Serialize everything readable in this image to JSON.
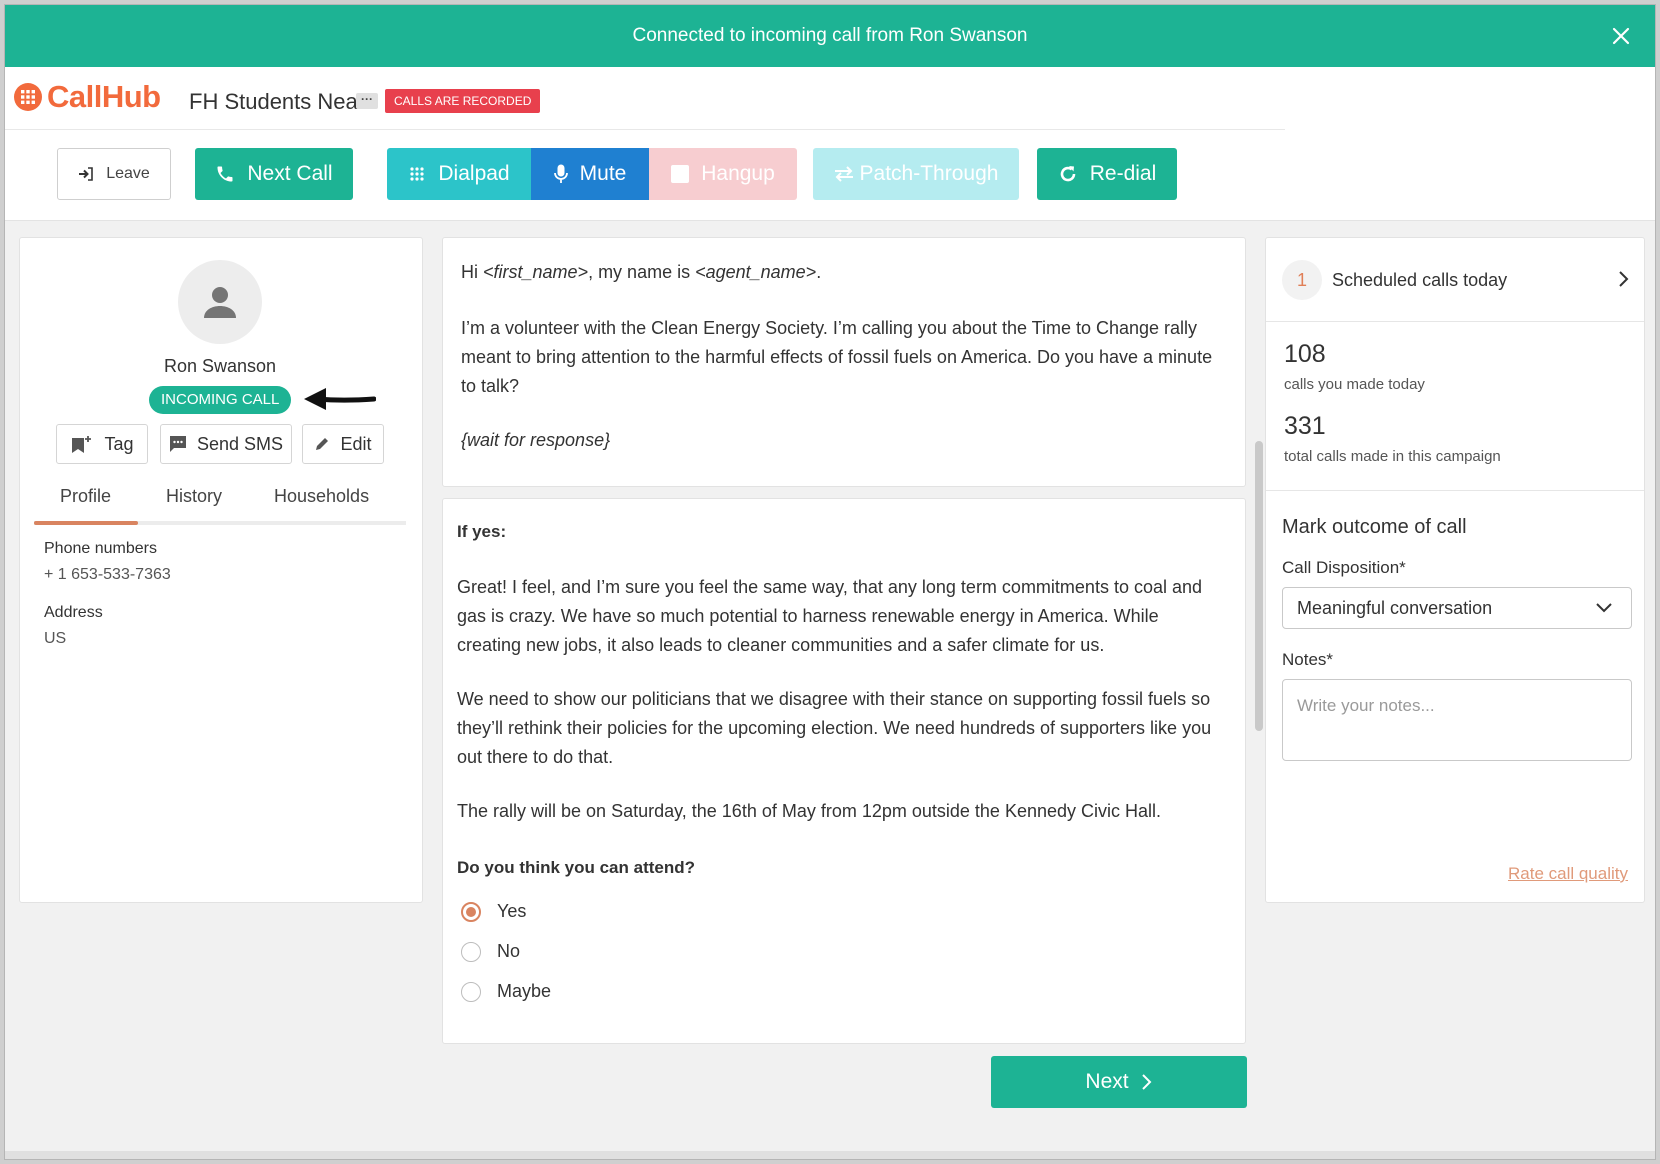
{
  "banner": {
    "message": "Connected to incoming call from Ron Swanson"
  },
  "header": {
    "logo_text": "CallHub",
    "campaign_name": "FH Students Nea",
    "campaign_more": "···",
    "recorded_badge": "CALLS ARE RECORDED"
  },
  "toolbar": {
    "leave": "Leave",
    "next_call": "Next Call",
    "dialpad": "Dialpad",
    "mute": "Mute",
    "hangup": "Hangup",
    "patch_through": "Patch-Through",
    "redial": "Re-dial"
  },
  "contact": {
    "name": "Ron Swanson",
    "status_badge": "INCOMING CALL",
    "actions": {
      "tag": "Tag",
      "send_sms": "Send SMS",
      "edit": "Edit"
    },
    "tabs": [
      "Profile",
      "History",
      "Households"
    ],
    "active_tab": "Profile",
    "phone_label": "Phone numbers",
    "phone_value": "+ 1 653-533-7363",
    "address_label": "Address",
    "address_value": "US"
  },
  "script": {
    "intro_hi": "Hi ",
    "intro_first_name": "<first_name>",
    "intro_mid": ", my name is ",
    "intro_agent_name": "<agent_name>",
    "intro_end": ".",
    "intro_p2": "I’m a volunteer with the Clean Energy Society. I’m calling you about the Time to Change rally meant to bring attention to the harmful effects of fossil fuels on America. Do you have a minute to talk?",
    "intro_wait": "{wait for response}",
    "if_yes": "If yes:",
    "p1": "Great! I feel, and I’m sure you feel the same way, that any long term commitments to coal and gas is crazy. We have so much potential to harness renewable energy in America. While creating new jobs, it also leads to cleaner communities and a safer climate for us.",
    "p2": "We need to show our politicians that we disagree with their stance on supporting fossil fuels so they’ll rethink their policies for the upcoming election. We need hundreds of supporters like you out there to do that.",
    "p3": "The rally will be on Saturday, the 16th of May from 12pm outside the Kennedy Civic Hall.",
    "question": "Do you think you can attend?",
    "options": [
      "Yes",
      "No",
      "Maybe"
    ],
    "selected_option": "Yes",
    "next": "Next"
  },
  "sidebar": {
    "scheduled_count": "1",
    "scheduled_label": "Scheduled calls today",
    "calls_today_num": "108",
    "calls_today_label": "calls you made today",
    "total_calls_num": "331",
    "total_calls_label": "total calls made in this campaign",
    "outcome_title": "Mark outcome of call",
    "disposition_label": "Call Disposition*",
    "disposition_value": "Meaningful conversation",
    "notes_label": "Notes*",
    "notes_placeholder": "Write your notes...",
    "rate_link": "Rate call quality"
  },
  "colors": {
    "brand_green": "#1db394",
    "accent_orange": "#d98460",
    "logo_orange": "#f26a3c",
    "mute_blue": "#1f80d1",
    "dialpad_cyan": "#2cc4c9",
    "recorded_red": "#e8404d"
  }
}
